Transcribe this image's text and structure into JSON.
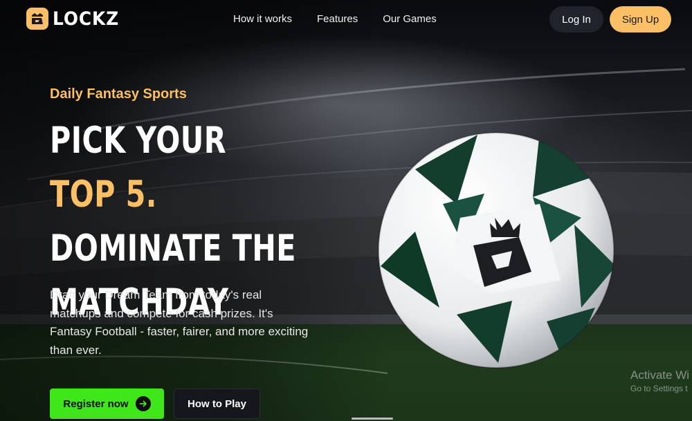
{
  "brand": {
    "name": "LOCKZ",
    "logo_icon": "lockz-logo-icon",
    "accent_color": "#fbbf66"
  },
  "nav": {
    "items": [
      "How it works",
      "Features",
      "Our Games"
    ]
  },
  "auth": {
    "login_label": "Log In",
    "signup_label": "Sign Up"
  },
  "hero": {
    "eyebrow": "Daily Fantasy Sports",
    "headline_part1": "PICK YOUR ",
    "headline_accent": "TOP 5.",
    "headline_part2": "DOMINATE THE MATCHDAY",
    "description": "Draft your Dream Team from today's real matchups and compete for cash prizes. It's Fantasy Football - faster, fairer, and more exciting than ever.",
    "register_label": "Register now",
    "register_icon": "arrow-right-icon",
    "howto_label": "How to Play",
    "register_color": "#3fe71a"
  },
  "watermark": {
    "title": "Activate Wi",
    "subtitle": "Go to Settings t"
  }
}
